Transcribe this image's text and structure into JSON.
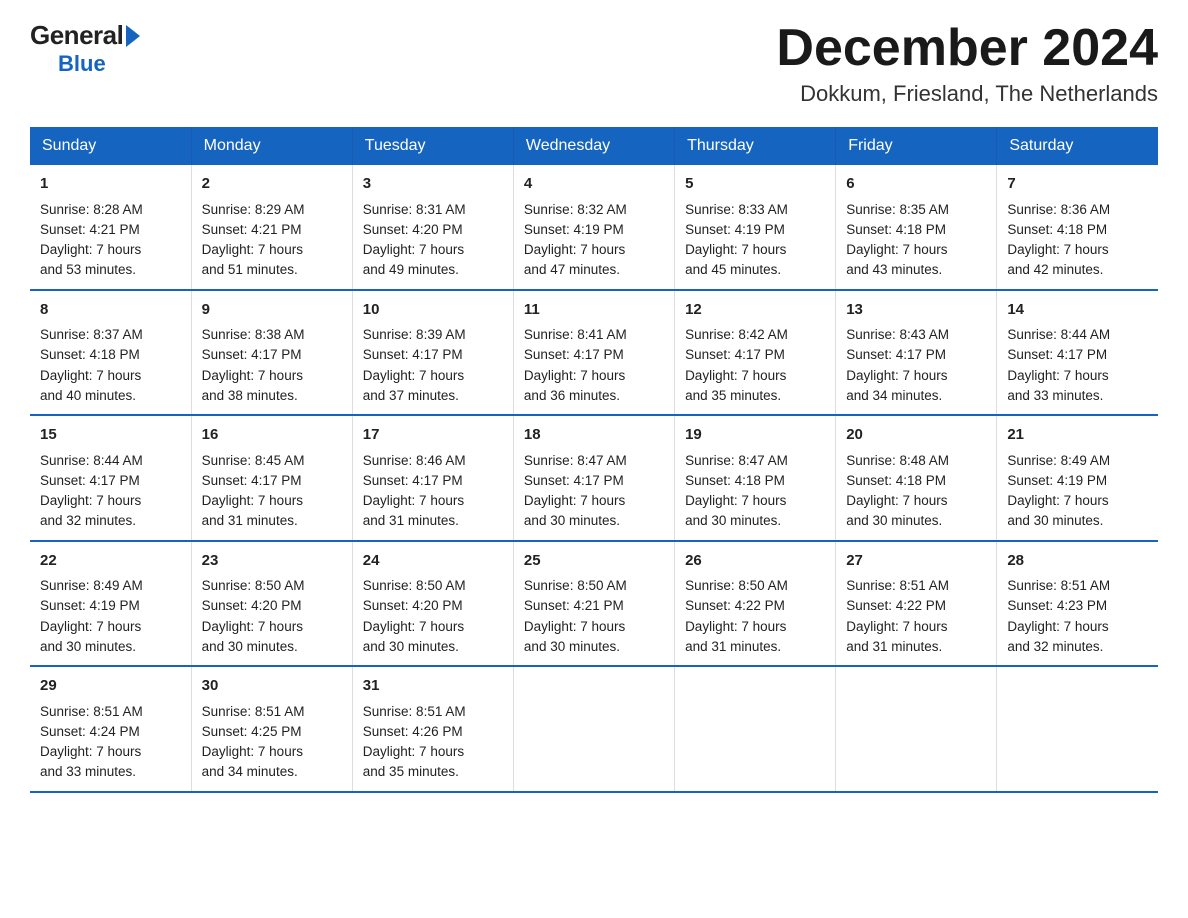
{
  "logo": {
    "general": "General",
    "blue": "Blue"
  },
  "title": {
    "month_year": "December 2024",
    "location": "Dokkum, Friesland, The Netherlands"
  },
  "header": {
    "days": [
      "Sunday",
      "Monday",
      "Tuesday",
      "Wednesday",
      "Thursday",
      "Friday",
      "Saturday"
    ]
  },
  "weeks": [
    {
      "days": [
        {
          "num": "1",
          "sunrise": "Sunrise: 8:28 AM",
          "sunset": "Sunset: 4:21 PM",
          "daylight": "Daylight: 7 hours",
          "minutes": "and 53 minutes."
        },
        {
          "num": "2",
          "sunrise": "Sunrise: 8:29 AM",
          "sunset": "Sunset: 4:21 PM",
          "daylight": "Daylight: 7 hours",
          "minutes": "and 51 minutes."
        },
        {
          "num": "3",
          "sunrise": "Sunrise: 8:31 AM",
          "sunset": "Sunset: 4:20 PM",
          "daylight": "Daylight: 7 hours",
          "minutes": "and 49 minutes."
        },
        {
          "num": "4",
          "sunrise": "Sunrise: 8:32 AM",
          "sunset": "Sunset: 4:19 PM",
          "daylight": "Daylight: 7 hours",
          "minutes": "and 47 minutes."
        },
        {
          "num": "5",
          "sunrise": "Sunrise: 8:33 AM",
          "sunset": "Sunset: 4:19 PM",
          "daylight": "Daylight: 7 hours",
          "minutes": "and 45 minutes."
        },
        {
          "num": "6",
          "sunrise": "Sunrise: 8:35 AM",
          "sunset": "Sunset: 4:18 PM",
          "daylight": "Daylight: 7 hours",
          "minutes": "and 43 minutes."
        },
        {
          "num": "7",
          "sunrise": "Sunrise: 8:36 AM",
          "sunset": "Sunset: 4:18 PM",
          "daylight": "Daylight: 7 hours",
          "minutes": "and 42 minutes."
        }
      ]
    },
    {
      "days": [
        {
          "num": "8",
          "sunrise": "Sunrise: 8:37 AM",
          "sunset": "Sunset: 4:18 PM",
          "daylight": "Daylight: 7 hours",
          "minutes": "and 40 minutes."
        },
        {
          "num": "9",
          "sunrise": "Sunrise: 8:38 AM",
          "sunset": "Sunset: 4:17 PM",
          "daylight": "Daylight: 7 hours",
          "minutes": "and 38 minutes."
        },
        {
          "num": "10",
          "sunrise": "Sunrise: 8:39 AM",
          "sunset": "Sunset: 4:17 PM",
          "daylight": "Daylight: 7 hours",
          "minutes": "and 37 minutes."
        },
        {
          "num": "11",
          "sunrise": "Sunrise: 8:41 AM",
          "sunset": "Sunset: 4:17 PM",
          "daylight": "Daylight: 7 hours",
          "minutes": "and 36 minutes."
        },
        {
          "num": "12",
          "sunrise": "Sunrise: 8:42 AM",
          "sunset": "Sunset: 4:17 PM",
          "daylight": "Daylight: 7 hours",
          "minutes": "and 35 minutes."
        },
        {
          "num": "13",
          "sunrise": "Sunrise: 8:43 AM",
          "sunset": "Sunset: 4:17 PM",
          "daylight": "Daylight: 7 hours",
          "minutes": "and 34 minutes."
        },
        {
          "num": "14",
          "sunrise": "Sunrise: 8:44 AM",
          "sunset": "Sunset: 4:17 PM",
          "daylight": "Daylight: 7 hours",
          "minutes": "and 33 minutes."
        }
      ]
    },
    {
      "days": [
        {
          "num": "15",
          "sunrise": "Sunrise: 8:44 AM",
          "sunset": "Sunset: 4:17 PM",
          "daylight": "Daylight: 7 hours",
          "minutes": "and 32 minutes."
        },
        {
          "num": "16",
          "sunrise": "Sunrise: 8:45 AM",
          "sunset": "Sunset: 4:17 PM",
          "daylight": "Daylight: 7 hours",
          "minutes": "and 31 minutes."
        },
        {
          "num": "17",
          "sunrise": "Sunrise: 8:46 AM",
          "sunset": "Sunset: 4:17 PM",
          "daylight": "Daylight: 7 hours",
          "minutes": "and 31 minutes."
        },
        {
          "num": "18",
          "sunrise": "Sunrise: 8:47 AM",
          "sunset": "Sunset: 4:17 PM",
          "daylight": "Daylight: 7 hours",
          "minutes": "and 30 minutes."
        },
        {
          "num": "19",
          "sunrise": "Sunrise: 8:47 AM",
          "sunset": "Sunset: 4:18 PM",
          "daylight": "Daylight: 7 hours",
          "minutes": "and 30 minutes."
        },
        {
          "num": "20",
          "sunrise": "Sunrise: 8:48 AM",
          "sunset": "Sunset: 4:18 PM",
          "daylight": "Daylight: 7 hours",
          "minutes": "and 30 minutes."
        },
        {
          "num": "21",
          "sunrise": "Sunrise: 8:49 AM",
          "sunset": "Sunset: 4:19 PM",
          "daylight": "Daylight: 7 hours",
          "minutes": "and 30 minutes."
        }
      ]
    },
    {
      "days": [
        {
          "num": "22",
          "sunrise": "Sunrise: 8:49 AM",
          "sunset": "Sunset: 4:19 PM",
          "daylight": "Daylight: 7 hours",
          "minutes": "and 30 minutes."
        },
        {
          "num": "23",
          "sunrise": "Sunrise: 8:50 AM",
          "sunset": "Sunset: 4:20 PM",
          "daylight": "Daylight: 7 hours",
          "minutes": "and 30 minutes."
        },
        {
          "num": "24",
          "sunrise": "Sunrise: 8:50 AM",
          "sunset": "Sunset: 4:20 PM",
          "daylight": "Daylight: 7 hours",
          "minutes": "and 30 minutes."
        },
        {
          "num": "25",
          "sunrise": "Sunrise: 8:50 AM",
          "sunset": "Sunset: 4:21 PM",
          "daylight": "Daylight: 7 hours",
          "minutes": "and 30 minutes."
        },
        {
          "num": "26",
          "sunrise": "Sunrise: 8:50 AM",
          "sunset": "Sunset: 4:22 PM",
          "daylight": "Daylight: 7 hours",
          "minutes": "and 31 minutes."
        },
        {
          "num": "27",
          "sunrise": "Sunrise: 8:51 AM",
          "sunset": "Sunset: 4:22 PM",
          "daylight": "Daylight: 7 hours",
          "minutes": "and 31 minutes."
        },
        {
          "num": "28",
          "sunrise": "Sunrise: 8:51 AM",
          "sunset": "Sunset: 4:23 PM",
          "daylight": "Daylight: 7 hours",
          "minutes": "and 32 minutes."
        }
      ]
    },
    {
      "days": [
        {
          "num": "29",
          "sunrise": "Sunrise: 8:51 AM",
          "sunset": "Sunset: 4:24 PM",
          "daylight": "Daylight: 7 hours",
          "minutes": "and 33 minutes."
        },
        {
          "num": "30",
          "sunrise": "Sunrise: 8:51 AM",
          "sunset": "Sunset: 4:25 PM",
          "daylight": "Daylight: 7 hours",
          "minutes": "and 34 minutes."
        },
        {
          "num": "31",
          "sunrise": "Sunrise: 8:51 AM",
          "sunset": "Sunset: 4:26 PM",
          "daylight": "Daylight: 7 hours",
          "minutes": "and 35 minutes."
        },
        {
          "num": "",
          "sunrise": "",
          "sunset": "",
          "daylight": "",
          "minutes": ""
        },
        {
          "num": "",
          "sunrise": "",
          "sunset": "",
          "daylight": "",
          "minutes": ""
        },
        {
          "num": "",
          "sunrise": "",
          "sunset": "",
          "daylight": "",
          "minutes": ""
        },
        {
          "num": "",
          "sunrise": "",
          "sunset": "",
          "daylight": "",
          "minutes": ""
        }
      ]
    }
  ]
}
